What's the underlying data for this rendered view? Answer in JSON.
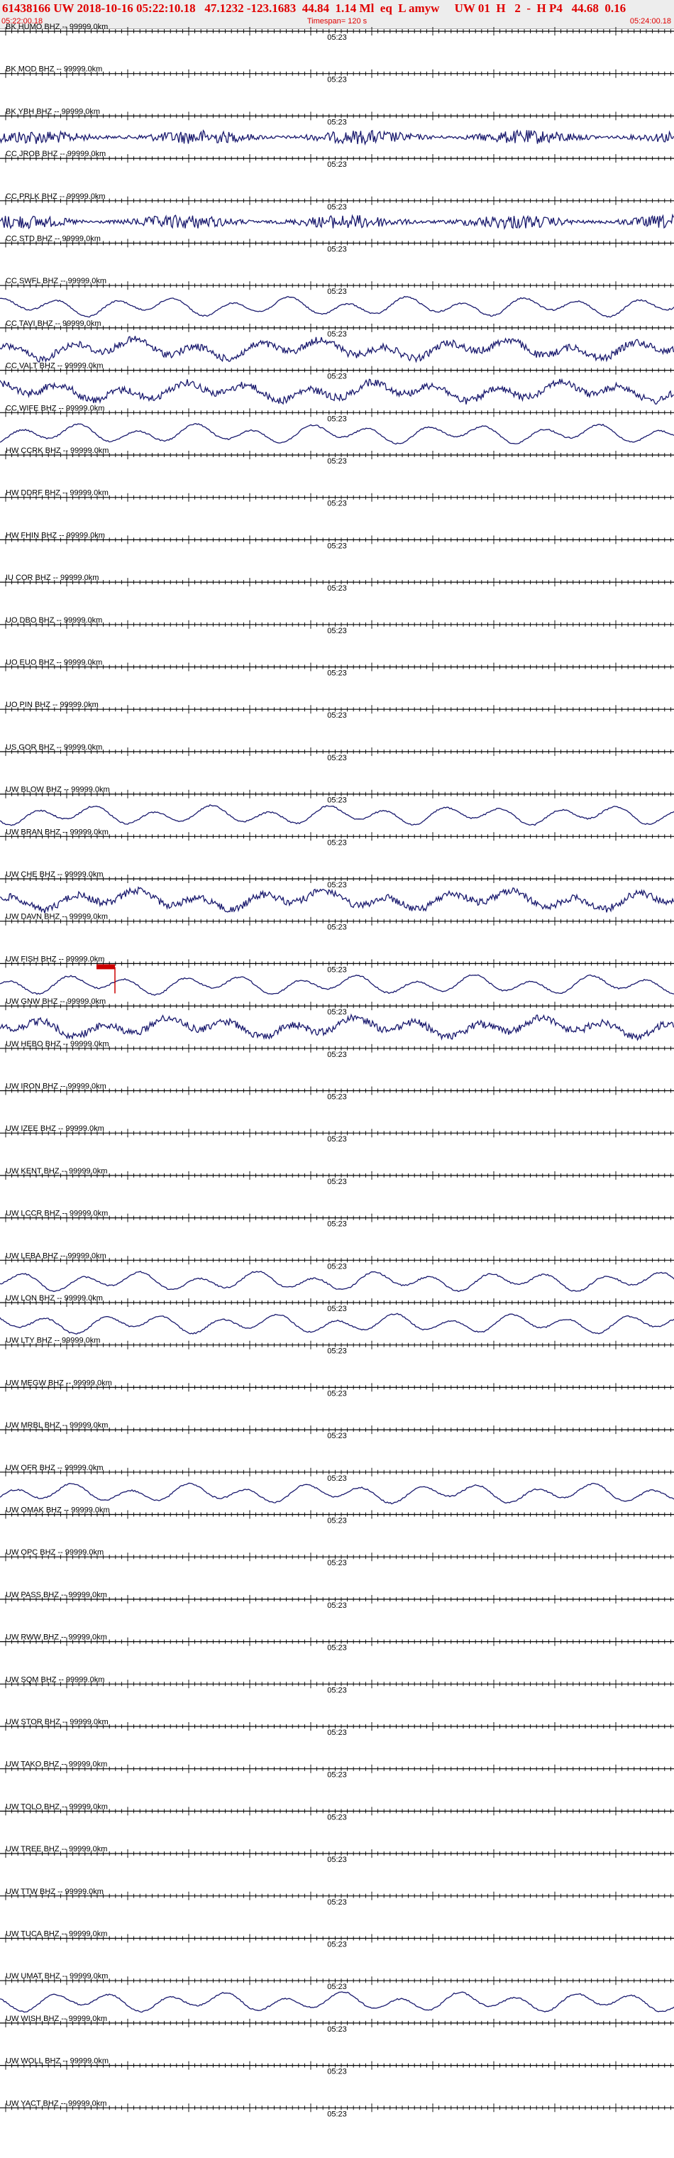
{
  "header": {
    "event_line": "61438166 UW 2018-10-16 05:22:10.18   47.1232 -123.1683  44.84  1.14 Ml  eq  L amyw     UW 01  H   2  -  H P4   44.68  0.16",
    "start_time": "05:22:00.18",
    "timespan": "Timespan= 120 s",
    "end_time": "05:24:00.18"
  },
  "time_label": "05:23",
  "colors": {
    "header_text": "#e00000",
    "trace": "#1a1a6e",
    "pick": "#cc0000"
  },
  "channels": [
    {
      "label": "BK HUMO BHZ -- 99999.0km",
      "active": false
    },
    {
      "label": "BK MOD BHZ -- 99999.0km",
      "active": false
    },
    {
      "label": "BK YBH BHZ -- 99999.0km",
      "active": true,
      "style": "noisy"
    },
    {
      "label": "CC JROB BHZ -- 99999.0km",
      "active": false
    },
    {
      "label": "CC PRLK BHZ -- 99999.0km",
      "active": true,
      "style": "noisy"
    },
    {
      "label": "CC STD BHZ -- 99999.0km",
      "active": false
    },
    {
      "label": "CC SWFL BHZ -- 99999.0km",
      "active": true,
      "style": "wave"
    },
    {
      "label": "CC TAVI BHZ -- 99999.0km",
      "active": true,
      "style": "noisy-wave"
    },
    {
      "label": "CC VALT BHZ -- 99999.0km",
      "active": true,
      "style": "noisy-wave"
    },
    {
      "label": "CC WIFE BHZ -- 99999.0km",
      "active": true,
      "style": "wave"
    },
    {
      "label": "HW CCRK BHZ -- 99999.0km",
      "active": false
    },
    {
      "label": "HW DDRF BHZ -- 99999.0km",
      "active": false
    },
    {
      "label": "HW FHIN BHZ -- 99999.0km",
      "active": false
    },
    {
      "label": "IU COR BHZ -- 99999.0km",
      "active": false
    },
    {
      "label": "UO DBO BHZ -- 99999.0km",
      "active": false
    },
    {
      "label": "UO EUO BHZ -- 99999.0km",
      "active": false
    },
    {
      "label": "UO PIN BHZ -- 99999.0km",
      "active": false
    },
    {
      "label": "US GOR BHZ -- 99999.0km",
      "active": false
    },
    {
      "label": "UW BLOW BHZ -- 99999.0km",
      "active": true,
      "style": "wave"
    },
    {
      "label": "UW BRAN BHZ -- 99999.0km",
      "active": false
    },
    {
      "label": "UW CHE BHZ -- 99999.0km",
      "active": true,
      "style": "noisy-wave"
    },
    {
      "label": "UW DAVN BHZ -- 99999.0km",
      "active": false
    },
    {
      "label": "UW FISH BHZ -- 99999.0km",
      "active": true,
      "style": "wave",
      "pick": true
    },
    {
      "label": "UW GNW BHZ -- 99999.0km",
      "active": true,
      "style": "noisy-wave"
    },
    {
      "label": "UW HEBO BHZ -- 99999.0km",
      "active": false
    },
    {
      "label": "UW IRON BHZ -- 99999.0km",
      "active": false
    },
    {
      "label": "UW IZEE BHZ -- 99999.0km",
      "active": false
    },
    {
      "label": "UW KENT BHZ -- 99999.0km",
      "active": false
    },
    {
      "label": "UW LCCR BHZ -- 99999.0km",
      "active": false
    },
    {
      "label": "UW LEBA BHZ -- 99999.0km",
      "active": true,
      "style": "wave"
    },
    {
      "label": "UW LON BHZ -- 99999.0km",
      "active": true,
      "style": "wave"
    },
    {
      "label": "UW LTY BHZ -- 99999.0km",
      "active": false
    },
    {
      "label": "UW MEGW BHZ -- 99999.0km",
      "active": false
    },
    {
      "label": "UW MRBL BHZ -- 99999.0km",
      "active": false
    },
    {
      "label": "UW OFR BHZ -- 99999.0km",
      "active": true,
      "style": "wave"
    },
    {
      "label": "UW OMAK BHZ -- 99999.0km",
      "active": false
    },
    {
      "label": "UW OPC BHZ -- 99999.0km",
      "active": false
    },
    {
      "label": "UW PASS BHZ -- 99999.0km",
      "active": false
    },
    {
      "label": "UW RWW BHZ -- 99999.0km",
      "active": false
    },
    {
      "label": "UW SQM BHZ -- 99999.0km",
      "active": false
    },
    {
      "label": "UW STOR BHZ -- 99999.0km",
      "active": false
    },
    {
      "label": "UW TAKO BHZ -- 99999.0km",
      "active": false
    },
    {
      "label": "UW TOLO BHZ -- 99999.0km",
      "active": false
    },
    {
      "label": "UW TREE BHZ -- 99999.0km",
      "active": false
    },
    {
      "label": "UW TTW BHZ -- 99999.0km",
      "active": false
    },
    {
      "label": "UW TUCA BHZ -- 99999.0km",
      "active": false
    },
    {
      "label": "UW UMAT BHZ -- 99999.0km",
      "active": true,
      "style": "wave"
    },
    {
      "label": "UW WISH BHZ -- 99999.0km",
      "active": false
    },
    {
      "label": "UW WOLL BHZ -- 99999.0km",
      "active": false
    },
    {
      "label": "UW YACT BHZ -- 99999.0km",
      "active": false
    }
  ]
}
